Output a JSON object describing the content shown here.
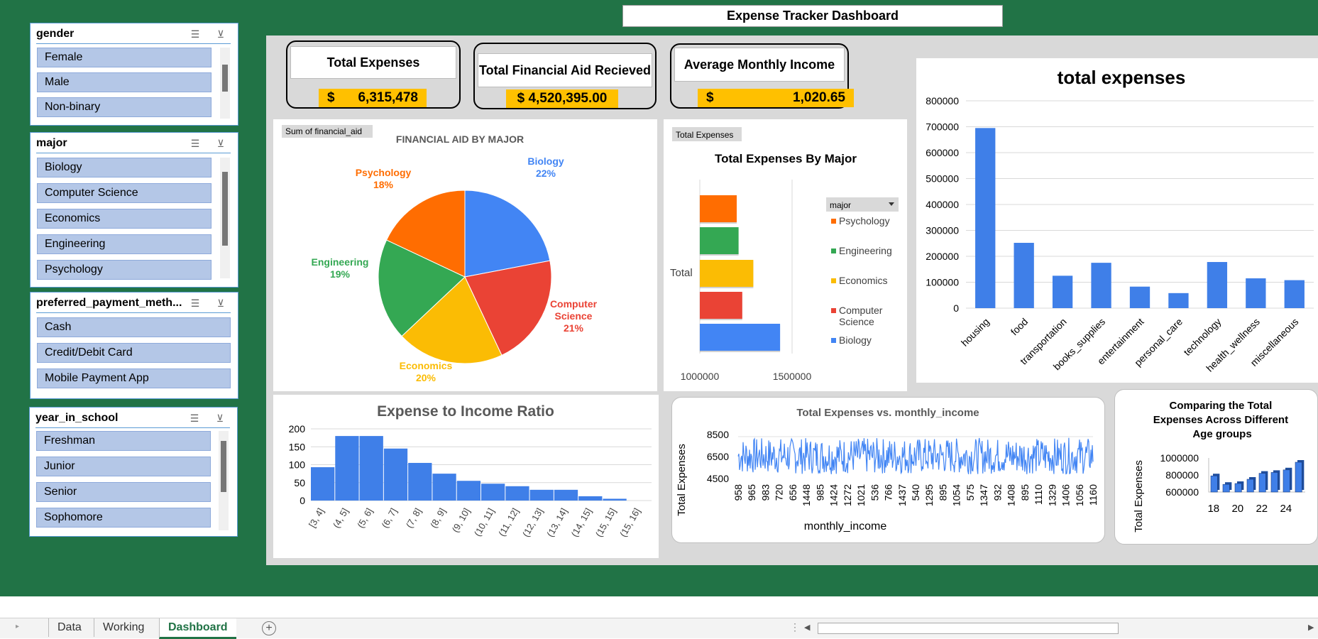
{
  "dashboard": {
    "title": "Expense Tracker Dashboard"
  },
  "kpis": {
    "total_expenses": {
      "label": "Total Expenses",
      "currency": "$",
      "value": "6,315,478"
    },
    "total_aid": {
      "label": "Total Financial Aid Recieved",
      "value": "$ 4,520,395.00"
    },
    "avg_income": {
      "label": "Average Monthly Income",
      "currency": "$",
      "value": "1,020.65"
    }
  },
  "slicers": {
    "gender": {
      "title": "gender",
      "items": [
        "Female",
        "Male",
        "Non-binary"
      ]
    },
    "major": {
      "title": "major",
      "items": [
        "Biology",
        "Computer Science",
        "Economics",
        "Engineering",
        "Psychology"
      ]
    },
    "payment": {
      "title": "preferred_payment_meth...",
      "items": [
        "Cash",
        "Credit/Debit Card",
        "Mobile Payment App"
      ]
    },
    "year": {
      "title": "year_in_school",
      "items": [
        "Freshman",
        "Junior",
        "Senior",
        "Sophomore"
      ]
    }
  },
  "icons": {
    "multi_select": "multi-select-icon",
    "clear_filter": "clear-filter-icon",
    "add_sheet": "add-sheet-icon"
  },
  "colors": {
    "green": "#217346",
    "blue": "#4285f4",
    "red": "#ea4335",
    "yellow": "#fbbc04",
    "greenSeries": "#34a853",
    "orange": "#ff6d01",
    "kpiYellow": "#ffc000"
  },
  "chart_data": [
    {
      "id": "pie",
      "type": "pie",
      "title": "FINANCIAL AID BY MAJOR",
      "field_button": "Sum of financial_aid",
      "categories": [
        "Biology",
        "Computer Science",
        "Economics",
        "Engineering",
        "Psychology"
      ],
      "values": [
        22,
        21,
        20,
        19,
        18
      ],
      "label_names": [
        "Biology",
        "Computer Science",
        "Economics",
        "Engineering",
        "Psychology"
      ],
      "label_pcts": [
        "22%",
        "21%",
        "20%",
        "19%",
        "18%"
      ],
      "colors": [
        "#4285f4",
        "#ea4335",
        "#fbbc04",
        "#34a853",
        "#ff6d01"
      ]
    },
    {
      "id": "hbar",
      "type": "bar",
      "title": "Total Expenses By Major",
      "field_button": "Total Expenses",
      "legend_title": "major",
      "category": "Total",
      "series": [
        {
          "name": "Psychology",
          "value": 1200000,
          "color": "#ff6d01"
        },
        {
          "name": "Engineering",
          "value": 1210000,
          "color": "#34a853"
        },
        {
          "name": "Economics",
          "value": 1290000,
          "color": "#fbbc04"
        },
        {
          "name": "Computer Science",
          "value": 1230000,
          "color": "#ea4335"
        },
        {
          "name": "Biology",
          "value": 1435000,
          "color": "#4285f4"
        }
      ],
      "x_ticks": [
        "1000000",
        "1500000"
      ],
      "xlim": [
        1000000,
        1650000
      ]
    },
    {
      "id": "bar",
      "type": "bar",
      "title": "total expenses",
      "categories": [
        "housing",
        "food",
        "transportation",
        "books_supplies",
        "entertainment",
        "personal_care",
        "technology",
        "health_wellness",
        "miscellaneous"
      ],
      "values": [
        695000,
        252000,
        125000,
        175000,
        83000,
        58000,
        178000,
        115000,
        108000
      ],
      "y_ticks": [
        "0",
        "100000",
        "200000",
        "300000",
        "400000",
        "500000",
        "600000",
        "700000",
        "800000"
      ],
      "ylim": [
        0,
        800000
      ]
    },
    {
      "id": "hist",
      "type": "bar",
      "title": "Expense to Income Ratio",
      "categories": [
        "[3, 4]",
        "(4, 5]",
        "(5, 6]",
        "(6, 7]",
        "(7, 8]",
        "(8, 9]",
        "(9, 10]",
        "(10, 11]",
        "(11, 12]",
        "(12, 13]",
        "(13, 14]",
        "(14, 15]",
        "(15, 15]",
        "(15, 16]"
      ],
      "values": [
        93,
        180,
        180,
        145,
        105,
        75,
        55,
        47,
        40,
        30,
        30,
        12,
        5,
        0
      ],
      "y_ticks": [
        "0",
        "50",
        "100",
        "150",
        "200"
      ],
      "ylim": [
        0,
        200
      ]
    },
    {
      "id": "line",
      "type": "line",
      "title": "Total Expenses vs. monthly_income",
      "xlabel": "monthly_income",
      "ylabel": "Total Expenses",
      "x_ticks": [
        "958",
        "965",
        "983",
        "720",
        "656",
        "1448",
        "985",
        "1424",
        "1272",
        "1021",
        "536",
        "766",
        "1437",
        "540",
        "1295",
        "895",
        "1054",
        "575",
        "1347",
        "932",
        "1408",
        "895",
        "1110",
        "1329",
        "1406",
        "1056",
        "1160"
      ],
      "y_ticks": [
        "4500",
        "6500",
        "8500"
      ],
      "ylim": [
        4500,
        8500
      ],
      "points": 500,
      "band": [
        4900,
        8200
      ]
    },
    {
      "id": "age",
      "type": "bar",
      "title": "Comparing the Total Expenses Across Different Age groups",
      "ylabel": "Total Expenses",
      "categories": [
        "18",
        "19",
        "20",
        "21",
        "22",
        "23",
        "24",
        "25"
      ],
      "x_ticks": [
        "18",
        "20",
        "22",
        "24"
      ],
      "values": [
        790000,
        690000,
        700000,
        750000,
        820000,
        830000,
        860000,
        950000
      ],
      "y_ticks": [
        "600000",
        "800000",
        "1000000"
      ],
      "ylim": [
        600000,
        1000000
      ]
    }
  ],
  "tabs": {
    "data": "Data",
    "working": "Working",
    "dashboard": "Dashboard"
  }
}
